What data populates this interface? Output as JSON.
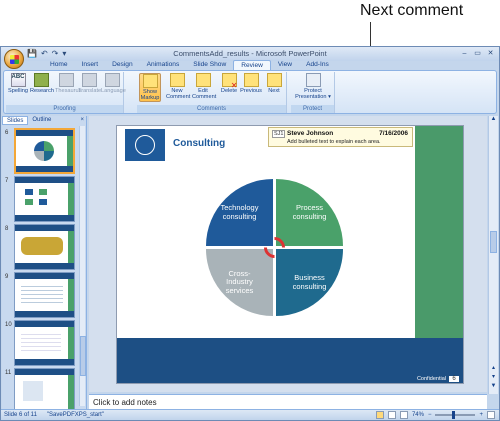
{
  "callout": {
    "label": "Next comment"
  },
  "window": {
    "title": "CommentsAdd_results - Microsoft PowerPoint",
    "qat": [
      "💾",
      "↶",
      "↷",
      "▾"
    ],
    "controls": [
      "–",
      "▭",
      "✕"
    ]
  },
  "tabs": [
    {
      "label": "Home",
      "active": false
    },
    {
      "label": "Insert",
      "active": false
    },
    {
      "label": "Design",
      "active": false
    },
    {
      "label": "Animations",
      "active": false
    },
    {
      "label": "Slide Show",
      "active": false
    },
    {
      "label": "Review",
      "active": true
    },
    {
      "label": "View",
      "active": false
    },
    {
      "label": "Add-Ins",
      "active": false
    }
  ],
  "ribbon": {
    "proofing": {
      "label": "Proofing",
      "spelling": "Spelling",
      "research": "Research",
      "thesaurus": "Thesaurus",
      "translate": "Translate",
      "language": "Language"
    },
    "comments": {
      "label": "Comments",
      "show_markup": "Show Markup",
      "new_comment": "New Comment",
      "edit_comment": "Edit Comment",
      "delete": "Delete",
      "previous": "Previous",
      "next": "Next"
    },
    "protect": {
      "label": "Protect",
      "protect_presentation": "Protect Presentation ▾"
    }
  },
  "slides_pane": {
    "tabs": [
      "Slides",
      "Outline"
    ],
    "close": "×",
    "thumbs": [
      {
        "num": "6",
        "selected": true
      },
      {
        "num": "7",
        "selected": false
      },
      {
        "num": "8",
        "selected": false
      },
      {
        "num": "9",
        "selected": false
      },
      {
        "num": "10",
        "selected": false
      },
      {
        "num": "11",
        "selected": false
      }
    ]
  },
  "slide": {
    "title": "Consulting",
    "quadrants": {
      "q1": "Technology\nconsulting",
      "q2": "Process\nconsulting",
      "q3": "Cross-\nIndustry\nservices",
      "q4": "Business\nconsulting"
    },
    "footer_text": "Confidential",
    "page_number": "6",
    "comment": {
      "initials": "SJ1",
      "author": "Steve Johnson",
      "date": "7/16/2006",
      "text": "Add bulleted text to explain each area."
    }
  },
  "notes": {
    "placeholder": "Click to add notes"
  },
  "statusbar": {
    "slide_info": "Slide 6 of 11",
    "theme": "\"SavePDFXPS_start\"",
    "zoom": "74%"
  },
  "colors": {
    "slide_blue": "#1f5a9a",
    "slide_green": "#4a9a6a",
    "comment_bg": "#fffbe0"
  }
}
